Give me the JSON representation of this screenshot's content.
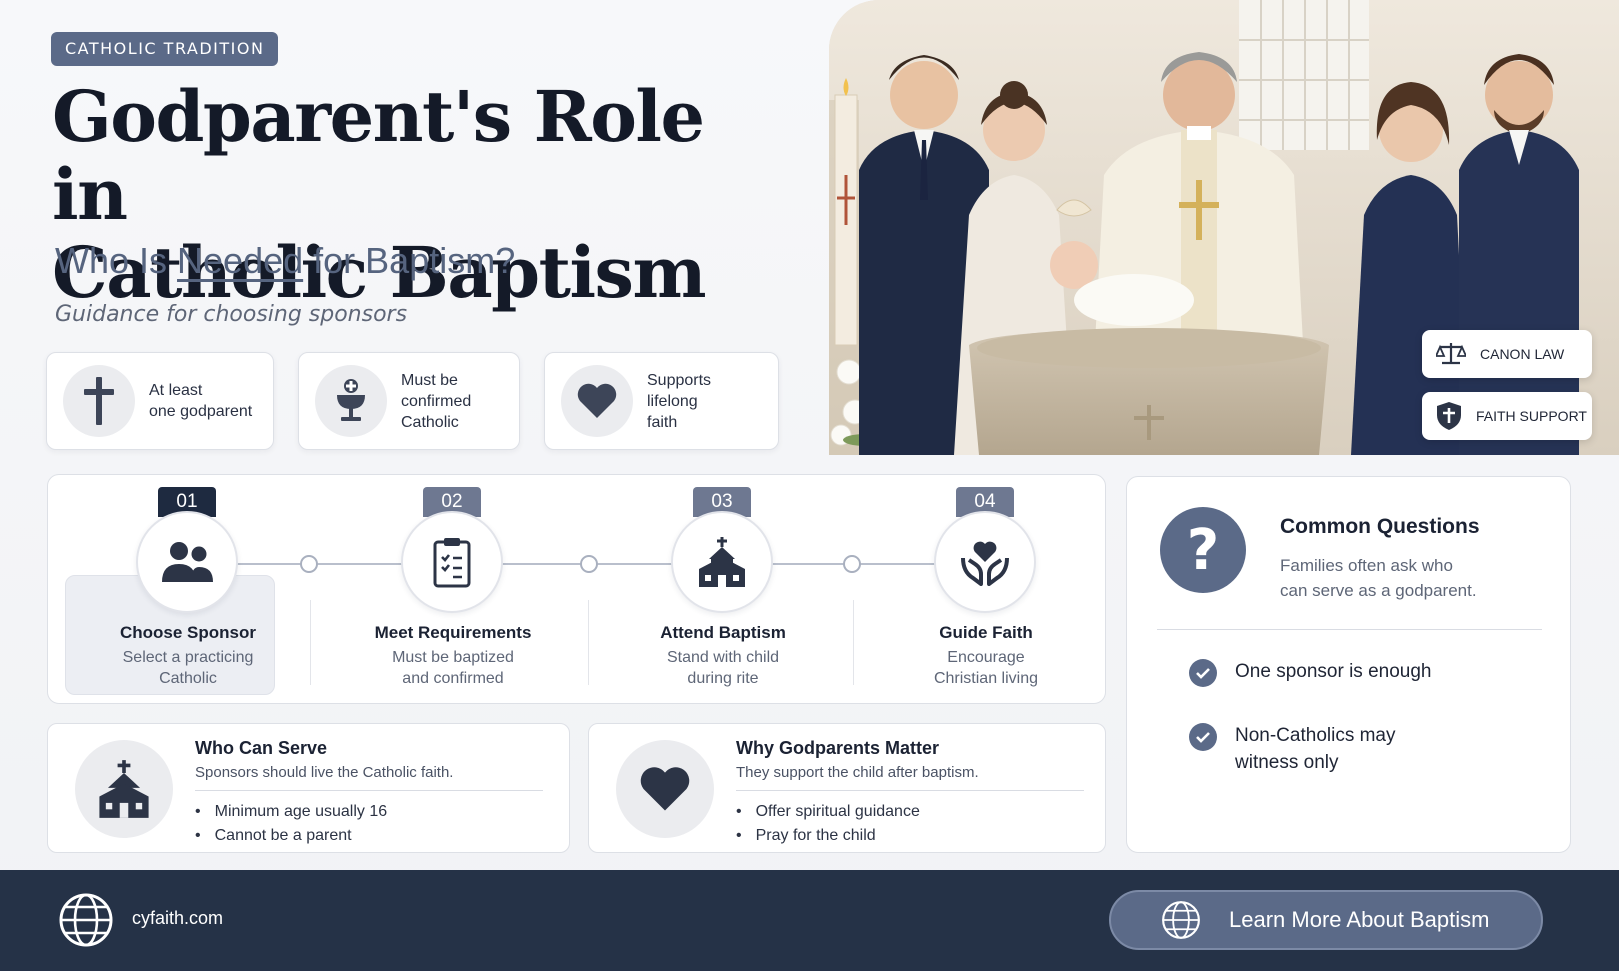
{
  "header": {
    "eyebrow": "CATHOLIC TRADITION",
    "title_line1": "Godparent's Role in",
    "title_line2": "Catholic Baptism",
    "subtitle_pre": "Who Is ",
    "subtitle_hl": "Needed",
    "subtitle_post": " for Baptism?",
    "guidance": "Guidance for choosing sponsors"
  },
  "features": [
    {
      "icon": "cross-icon",
      "text": "At least\none godparent"
    },
    {
      "icon": "chalice-icon",
      "text": "Must be\nconfirmed\nCatholic"
    },
    {
      "icon": "heart-icon",
      "text": "Supports\nlifelong\nfaith"
    }
  ],
  "hero": {
    "badges": [
      {
        "icon": "scales-icon",
        "label": "CANON LAW"
      },
      {
        "icon": "shield-cross-icon",
        "label": "FAITH SUPPORT"
      }
    ]
  },
  "steps": [
    {
      "num": "01",
      "icon": "people-icon",
      "title": "Choose Sponsor",
      "desc": "Select a practicing\nCatholic"
    },
    {
      "num": "02",
      "icon": "clipboard-icon",
      "title": "Meet Requirements",
      "desc": "Must be baptized\nand confirmed"
    },
    {
      "num": "03",
      "icon": "church-icon",
      "title": "Attend Baptism",
      "desc": "Stand with child\nduring rite"
    },
    {
      "num": "04",
      "icon": "hands-heart-icon",
      "title": "Guide Faith",
      "desc": "Encourage\nChristian living"
    }
  ],
  "info_cards": [
    {
      "icon": "church-icon",
      "title": "Who Can Serve",
      "sub": "Sponsors should live the Catholic faith.",
      "items": [
        "Minimum age usually 16",
        "Cannot be a parent"
      ]
    },
    {
      "icon": "heart-icon",
      "title": "Why Godparents Matter",
      "sub": "They support the child after baptism.",
      "items": [
        "Offer spiritual guidance",
        "Pray for the child"
      ]
    }
  ],
  "faq": {
    "icon": "question-icon",
    "title": "Common Questions",
    "sub": "Families often ask who\ncan serve as a godparent.",
    "items": [
      "One sponsor is enough",
      "Non-Catholics may\nwitness only"
    ]
  },
  "footer": {
    "site": "cyfaith.com",
    "cta": "Learn More About Baptism"
  },
  "colors": {
    "accent": "#5b6a88",
    "dark": "#253247",
    "active_num": "#1e2a40"
  }
}
